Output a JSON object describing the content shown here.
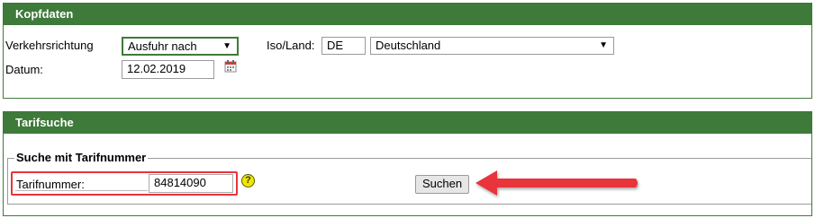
{
  "kopfdaten": {
    "title": "Kopfdaten",
    "verkehrsrichtung_label": "Verkehrsrichtung",
    "verkehrsrichtung_value": "Ausfuhr nach",
    "iso_land_label": "Iso/Land:",
    "iso_value": "DE",
    "land_value": "Deutschland",
    "datum_label": "Datum:",
    "datum_value": "12.02.2019"
  },
  "tarifsuche": {
    "title": "Tarifsuche",
    "group_title": "Suche mit Tarifnummer",
    "tarifnummer_label": "Tarifnummer:",
    "tarifnummer_value": "84814090",
    "help_glyph": "?",
    "search_button": "Suchen"
  },
  "icons": {
    "calendar": "calendar-icon",
    "help": "help-icon",
    "dropdown": "chevron-down-icon"
  },
  "colors": {
    "header_green": "#3e7a3a",
    "highlight_red": "#e8343a",
    "help_yellow": "#f2e600"
  }
}
